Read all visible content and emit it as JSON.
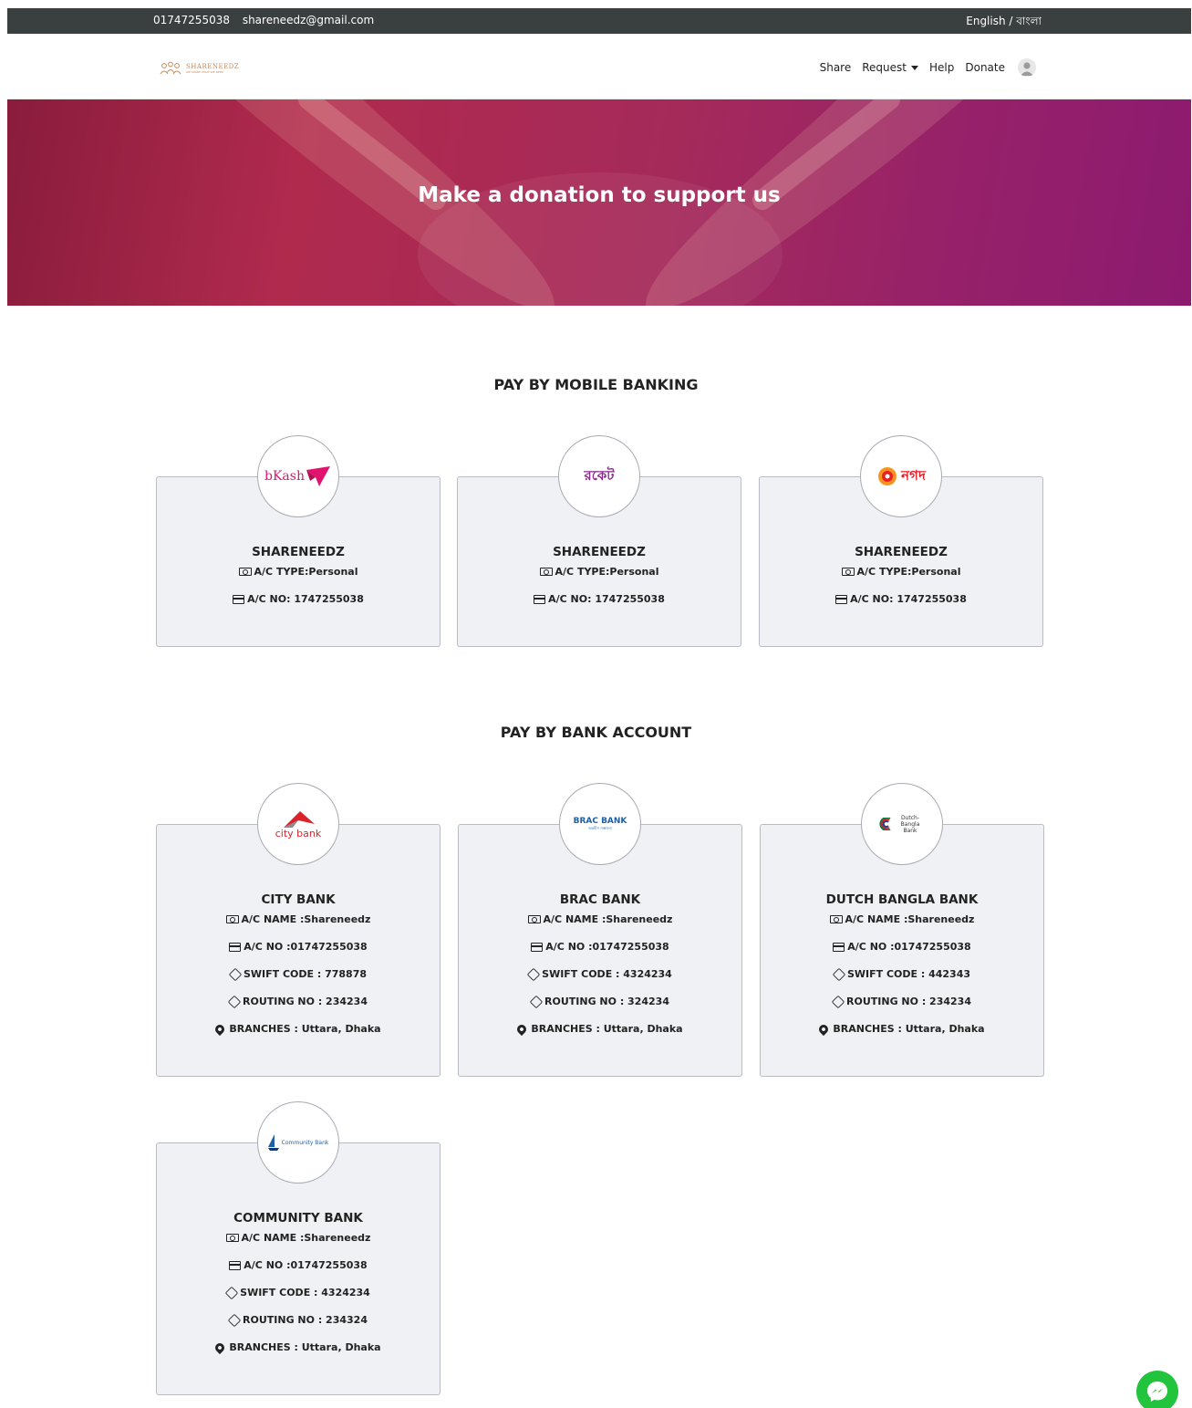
{
  "topbar": {
    "phone": "01747255038",
    "email": "shareneedz@gmail.com",
    "language": "English / বাংলা"
  },
  "brand": {
    "name": "SHARENEEDZ",
    "tagline": "WE SHARE WHAT WE NEED"
  },
  "nav": {
    "share": "Share",
    "request": "Request",
    "help": "Help",
    "donate": "Donate"
  },
  "hero": {
    "title": "Make a donation to support us"
  },
  "sections": {
    "mobile": "PAY BY MOBILE BANKING",
    "bank": "PAY BY BANK ACCOUNT"
  },
  "mobile_cards": [
    {
      "logo_text": "bKash",
      "title": "SHARENEEDZ",
      "type": "A/C TYPE:Personal",
      "number": "A/C NO: 1747255038"
    },
    {
      "logo_text": "রকেট",
      "title": "SHARENEEDZ",
      "type": "A/C TYPE:Personal",
      "number": "A/C NO: 1747255038"
    },
    {
      "logo_text": "নগদ",
      "title": "SHARENEEDZ",
      "type": "A/C TYPE:Personal",
      "number": "A/C NO: 1747255038"
    }
  ],
  "bank_cards": [
    {
      "logo_text": "city bank",
      "title": "CITY BANK",
      "name": "A/C NAME :Shareneedz",
      "number": "A/C NO :01747255038",
      "swift": "SWIFT CODE : 778878",
      "routing": "ROUTING NO : 234234",
      "branches": "BRANCHES : Uttara, Dhaka"
    },
    {
      "logo_text": "BRAC BANK",
      "logo_sub": "অন্তহীন সম্ভাবনা",
      "title": "BRAC BANK",
      "name": "A/C NAME :Shareneedz",
      "number": "A/C NO :01747255038",
      "swift": "SWIFT CODE : 4324234",
      "routing": "ROUTING NO : 324234",
      "branches": "BRANCHES : Uttara, Dhaka"
    },
    {
      "logo_text": "Dutch-Bangla Bank",
      "title": "DUTCH BANGLA BANK",
      "name": "A/C NAME :Shareneedz",
      "number": "A/C NO :01747255038",
      "swift": "SWIFT CODE : 442343",
      "routing": "ROUTING NO : 234234",
      "branches": "BRANCHES : Uttara, Dhaka"
    },
    {
      "logo_text": "Community Bank",
      "title": "COMMUNITY BANK",
      "name": "A/C NAME :Shareneedz",
      "number": "A/C NO :01747255038",
      "swift": "SWIFT CODE : 4324234",
      "routing": "ROUTING NO : 234324",
      "branches": "BRANCHES : Uttara, Dhaka"
    }
  ],
  "colors": {
    "topbar": "#3a3f40",
    "hero_start": "#8a1c3c",
    "hero_end": "#8c1a6f",
    "bkash": "#e2136e",
    "nagad": "#ec1c24",
    "citybank": "#d8232a",
    "brac": "#1f5fa6",
    "messenger": "#22c43d"
  }
}
